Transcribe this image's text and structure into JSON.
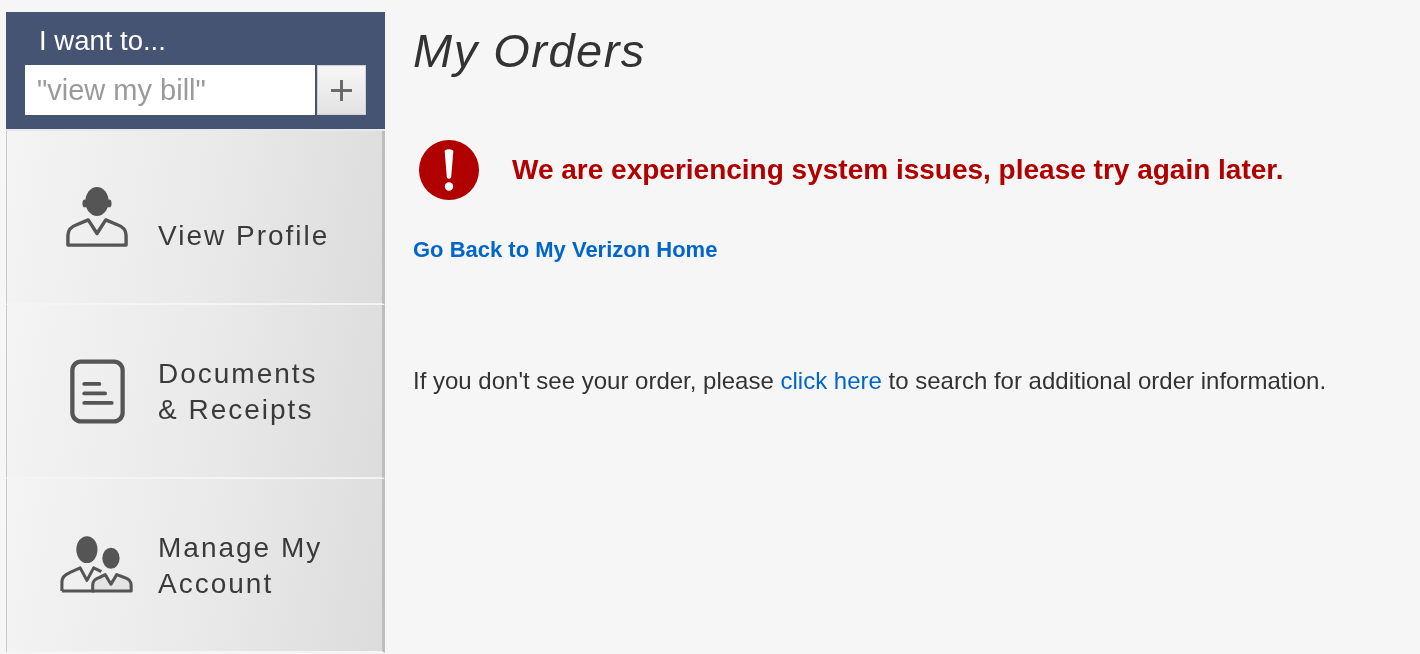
{
  "sidebar": {
    "title": "I want to...",
    "search": {
      "placeholder": "\"view my bill\""
    },
    "menu": [
      {
        "label": "View Profile",
        "kind": "profile"
      },
      {
        "label": "Documents & Receipts",
        "kind": "documents"
      },
      {
        "label": "Manage My Account",
        "kind": "account"
      }
    ]
  },
  "main": {
    "title": "My Orders",
    "alert": {
      "message": "We are experiencing system issues, please try again later."
    },
    "home_link": "Go Back to My Verizon Home",
    "note": {
      "before": "If you don't see your order, please ",
      "link": "click here",
      "after": " to search for additional order information."
    }
  }
}
